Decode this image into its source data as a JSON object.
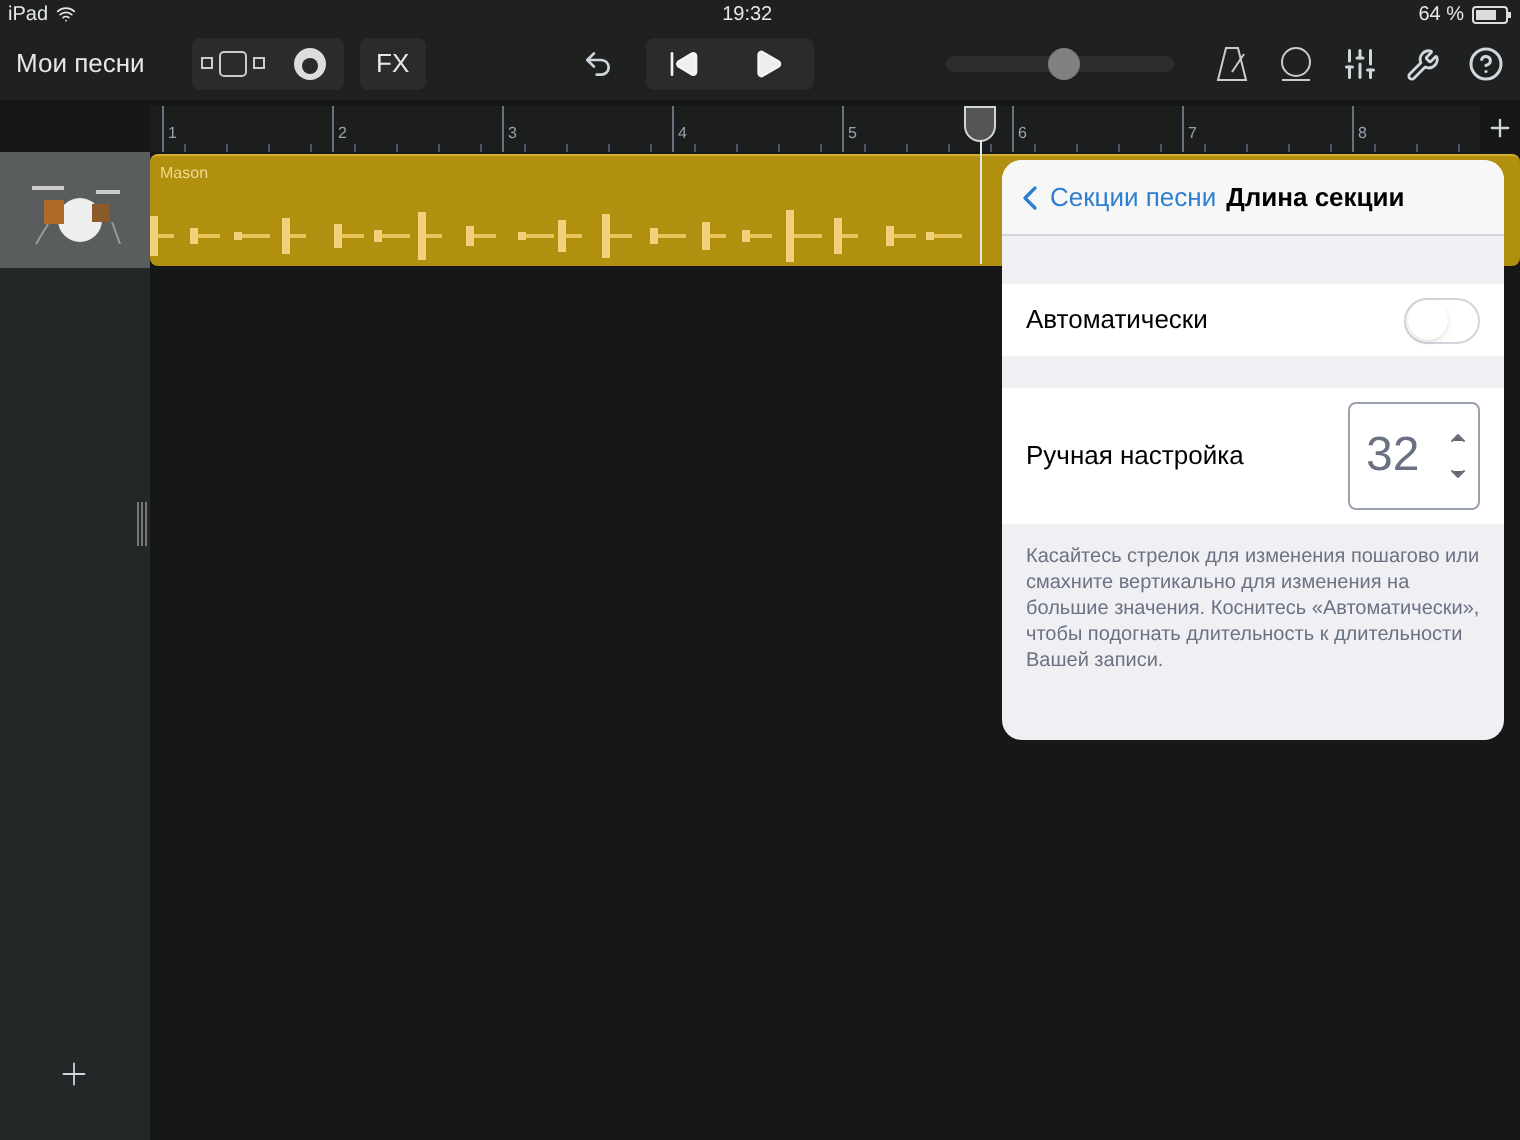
{
  "status_bar": {
    "device": "iPad",
    "time": "19:32",
    "battery": "64 %"
  },
  "toolbar": {
    "back": "Мои песни",
    "fx": "FX",
    "volume": {
      "level": 0.52
    }
  },
  "ruler": {
    "marks": [
      "1",
      "2",
      "3",
      "4",
      "5",
      "6",
      "7",
      "8"
    ]
  },
  "track": {
    "region": "Mason"
  },
  "popover": {
    "back": "Секции песни",
    "title": "Длина секции",
    "auto": {
      "label": "Автоматически",
      "on": false
    },
    "manual": {
      "label": "Ручная настройка",
      "value": "32"
    },
    "hint": "Касайтесь стрелок для изменения пошагово или смахните вертикально для изменения на большие значения. Коснитесь «Автоматически», чтобы подогнать длительность к длительности Вашей записи."
  }
}
